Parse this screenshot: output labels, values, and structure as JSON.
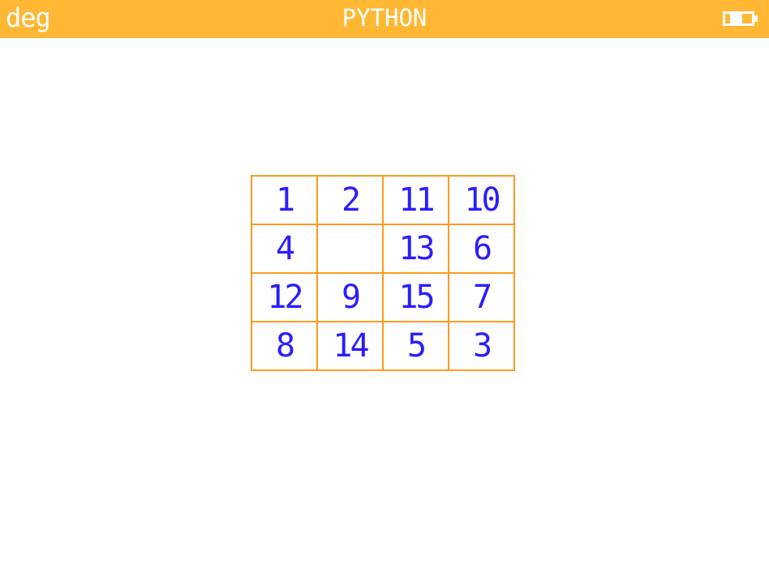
{
  "status_bar": {
    "angle_mode": "deg",
    "app_title": "PYTHON",
    "battery_icon": "battery-icon",
    "background_color": "#ffb734",
    "text_color": "#ffffff"
  },
  "puzzle": {
    "grid_color": "#ff9a1f",
    "number_color": "#2b1dff",
    "tiles": [
      "1",
      "2",
      "11",
      "10",
      "4",
      "",
      "13",
      "6",
      "12",
      "9",
      "15",
      "7",
      "8",
      "14",
      "5",
      "3"
    ]
  }
}
